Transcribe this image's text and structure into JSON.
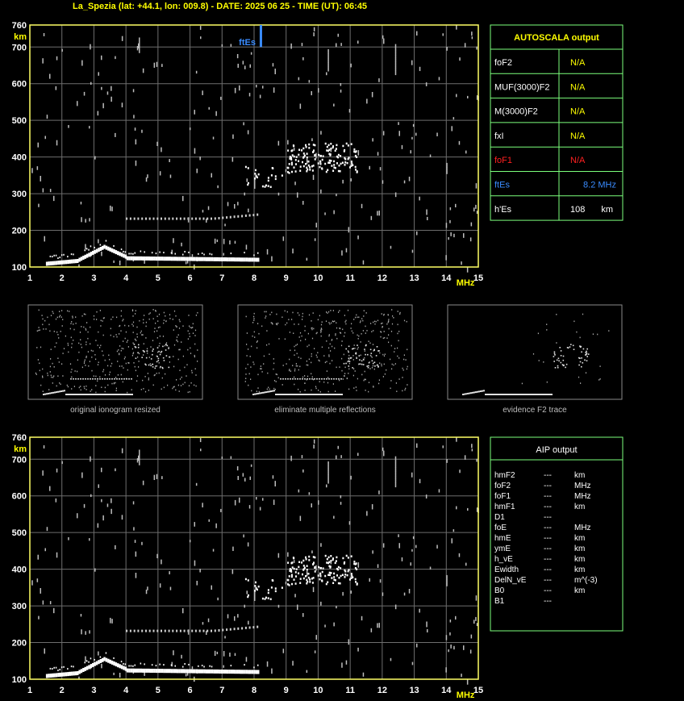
{
  "title": "La_Spezia (lat: +44.1, lon: 009.8) - DATE: 2025 06 25 - TIME (UT): 06:45",
  "colors": {
    "axis": "#ffff66",
    "grid": "#6e6e6e",
    "trace": "#ffffff",
    "box_border": "#7cff7c",
    "fof1": "#ff2020",
    "ftes": "#3a8cff",
    "label_yellow": "#ffff00"
  },
  "chart_data": [
    {
      "type": "scatter",
      "name": "main ionogram",
      "xlabel": "MHz",
      "ylabel": "km",
      "xlim": [
        1,
        15
      ],
      "ylim": [
        100,
        760
      ],
      "x_ticks": [
        "1",
        "2",
        "3",
        "4",
        "5",
        "6",
        "7",
        "8",
        "9",
        "10",
        "11",
        "12",
        "13",
        "14",
        "15"
      ],
      "y_ticks": [
        "100",
        "200",
        "300",
        "400",
        "500",
        "600",
        "700",
        "760"
      ],
      "grid": true,
      "marker": {
        "label": "ftEs",
        "freq_mhz": 8.2,
        "y_range_km": [
          700,
          760
        ]
      }
    },
    {
      "type": "scatter",
      "name": "AIP ionogram",
      "xlabel": "MHz",
      "ylabel": "km",
      "xlim": [
        1,
        15
      ],
      "ylim": [
        100,
        760
      ],
      "x_ticks": [
        "1",
        "2",
        "3",
        "4",
        "5",
        "6",
        "7",
        "8",
        "9",
        "10",
        "11",
        "12",
        "13",
        "14",
        "15"
      ],
      "y_ticks": [
        "100",
        "200",
        "300",
        "400",
        "500",
        "600",
        "700",
        "760"
      ],
      "grid": true
    }
  ],
  "thumbnails": [
    {
      "caption": "original ionogram resized"
    },
    {
      "caption": "eliminate multiple reflections"
    },
    {
      "caption": "evidence F2 trace"
    }
  ],
  "autoscala": {
    "title": "AUTOSCALA output",
    "rows": [
      {
        "label": "foF2",
        "value": "N/A",
        "unit": ""
      },
      {
        "label": "MUF(3000)F2",
        "value": "N/A",
        "unit": ""
      },
      {
        "label": "M(3000)F2",
        "value": "N/A",
        "unit": ""
      },
      {
        "label": "fxI",
        "value": "N/A",
        "unit": ""
      },
      {
        "label": "foF1",
        "value": "N/A",
        "unit": ""
      },
      {
        "label": "ftEs",
        "value": "8.2 MHz",
        "unit": ""
      },
      {
        "label": "h'Es",
        "value": "108",
        "unit": "km"
      }
    ]
  },
  "aip": {
    "title": "AIP output",
    "rows": [
      {
        "param": "hmF2",
        "value": "---",
        "unit": "km"
      },
      {
        "param": "foF2",
        "value": "---",
        "unit": "MHz"
      },
      {
        "param": "foF1",
        "value": "---",
        "unit": "MHz"
      },
      {
        "param": "hmF1",
        "value": "---",
        "unit": "km"
      },
      {
        "param": "D1",
        "value": "---",
        "unit": ""
      },
      {
        "param": "foE",
        "value": "---",
        "unit": "MHz"
      },
      {
        "param": "hmE",
        "value": "---",
        "unit": "km"
      },
      {
        "param": "ymE",
        "value": "---",
        "unit": "km"
      },
      {
        "param": "h_vE",
        "value": "---",
        "unit": "km"
      },
      {
        "param": "Ewidth",
        "value": "---",
        "unit": "km"
      },
      {
        "param": "DelN_vE",
        "value": "---",
        "unit": "m^(-3)"
      },
      {
        "param": "B0",
        "value": "---",
        "unit": "km"
      },
      {
        "param": "B1",
        "value": "---",
        "unit": ""
      }
    ]
  }
}
